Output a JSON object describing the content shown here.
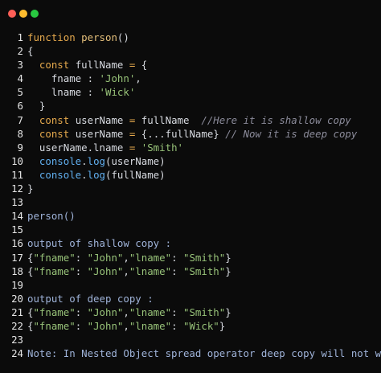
{
  "window": {
    "controls": [
      "close",
      "minimize",
      "maximize"
    ]
  },
  "code_lines": [
    {
      "n": "1",
      "tokens": [
        [
          "kw",
          "function"
        ],
        [
          "pl",
          " "
        ],
        [
          "fn",
          "person"
        ],
        [
          "pl",
          "()"
        ]
      ]
    },
    {
      "n": "2",
      "tokens": [
        [
          "pl",
          "{"
        ]
      ]
    },
    {
      "n": "3",
      "tokens": [
        [
          "pl",
          "  "
        ],
        [
          "kw",
          "const"
        ],
        [
          "pl",
          " fullName "
        ],
        [
          "kw",
          "="
        ],
        [
          "pl",
          " {"
        ]
      ]
    },
    {
      "n": "4",
      "tokens": [
        [
          "pl",
          "    fname : "
        ],
        [
          "str",
          "'John'"
        ],
        [
          "pl",
          ","
        ]
      ]
    },
    {
      "n": "5",
      "tokens": [
        [
          "pl",
          "    lname : "
        ],
        [
          "str",
          "'Wick'"
        ]
      ]
    },
    {
      "n": "6",
      "tokens": [
        [
          "pl",
          "  }"
        ]
      ]
    },
    {
      "n": "7",
      "tokens": [
        [
          "pl",
          "  "
        ],
        [
          "kw",
          "const"
        ],
        [
          "pl",
          " userName "
        ],
        [
          "kw",
          "="
        ],
        [
          "pl",
          " fullName  "
        ],
        [
          "cm",
          "//Here it is shallow copy"
        ]
      ]
    },
    {
      "n": "8",
      "tokens": [
        [
          "pl",
          "  "
        ],
        [
          "kw",
          "const"
        ],
        [
          "pl",
          " userName "
        ],
        [
          "kw",
          "="
        ],
        [
          "pl",
          " {...fullName} "
        ],
        [
          "cm",
          "// Now it is deep copy"
        ]
      ]
    },
    {
      "n": "9",
      "tokens": [
        [
          "pl",
          "  userName.lname "
        ],
        [
          "kw",
          "="
        ],
        [
          "pl",
          " "
        ],
        [
          "str",
          "'Smith'"
        ]
      ]
    },
    {
      "n": "10",
      "tokens": [
        [
          "pl",
          "  "
        ],
        [
          "blue",
          "console"
        ],
        [
          "pl",
          "."
        ],
        [
          "blue",
          "log"
        ],
        [
          "pl",
          "(userName)"
        ]
      ]
    },
    {
      "n": "11",
      "tokens": [
        [
          "pl",
          "  "
        ],
        [
          "blue",
          "console"
        ],
        [
          "pl",
          "."
        ],
        [
          "blue",
          "log"
        ],
        [
          "pl",
          "(fullName)"
        ]
      ]
    },
    {
      "n": "12",
      "tokens": [
        [
          "pl",
          "}"
        ]
      ]
    },
    {
      "n": "13",
      "tokens": []
    },
    {
      "n": "14",
      "tokens": [
        [
          "note",
          "person()"
        ]
      ]
    },
    {
      "n": "15",
      "tokens": []
    },
    {
      "n": "16",
      "tokens": [
        [
          "note",
          "output of shallow copy :"
        ]
      ]
    },
    {
      "n": "17",
      "tokens": [
        [
          "pl",
          "{"
        ],
        [
          "str",
          "\"fname\""
        ],
        [
          "pl",
          ": "
        ],
        [
          "str",
          "\"John\""
        ],
        [
          "pl",
          ","
        ],
        [
          "str",
          "\"lname\""
        ],
        [
          "pl",
          ": "
        ],
        [
          "str",
          "\"Smith\""
        ],
        [
          "pl",
          "}"
        ]
      ]
    },
    {
      "n": "18",
      "tokens": [
        [
          "pl",
          "{"
        ],
        [
          "str",
          "\"fname\""
        ],
        [
          "pl",
          ": "
        ],
        [
          "str",
          "\"John\""
        ],
        [
          "pl",
          ","
        ],
        [
          "str",
          "\"lname\""
        ],
        [
          "pl",
          ": "
        ],
        [
          "str",
          "\"Smith\""
        ],
        [
          "pl",
          "}"
        ]
      ]
    },
    {
      "n": "19",
      "tokens": []
    },
    {
      "n": "20",
      "tokens": [
        [
          "note",
          "output of deep copy :"
        ]
      ]
    },
    {
      "n": "21",
      "tokens": [
        [
          "pl",
          "{"
        ],
        [
          "str",
          "\"fname\""
        ],
        [
          "pl",
          ": "
        ],
        [
          "str",
          "\"John\""
        ],
        [
          "pl",
          ","
        ],
        [
          "str",
          "\"lname\""
        ],
        [
          "pl",
          ": "
        ],
        [
          "str",
          "\"Smith\""
        ],
        [
          "pl",
          "}"
        ]
      ]
    },
    {
      "n": "22",
      "tokens": [
        [
          "pl",
          "{"
        ],
        [
          "str",
          "\"fname\""
        ],
        [
          "pl",
          ": "
        ],
        [
          "str",
          "\"John\""
        ],
        [
          "pl",
          ","
        ],
        [
          "str",
          "\"lname\""
        ],
        [
          "pl",
          ": "
        ],
        [
          "str",
          "\"Wick\""
        ],
        [
          "pl",
          "}"
        ]
      ]
    },
    {
      "n": "23",
      "tokens": []
    },
    {
      "n": "24",
      "tokens": [
        [
          "note",
          "Note: In Nested Object spread operator deep copy will not work"
        ]
      ]
    }
  ],
  "colors": {
    "background": "#0b0b0b",
    "keyword": "#e5a94d",
    "string": "#98c379",
    "comment": "#8b8b9a",
    "function": "#e5c07b",
    "plain": "#d7dae0",
    "method": "#61afef",
    "note": "#9fb3d9",
    "close": "#ff5f57",
    "minimize": "#febc2e",
    "maximize": "#28c840"
  }
}
